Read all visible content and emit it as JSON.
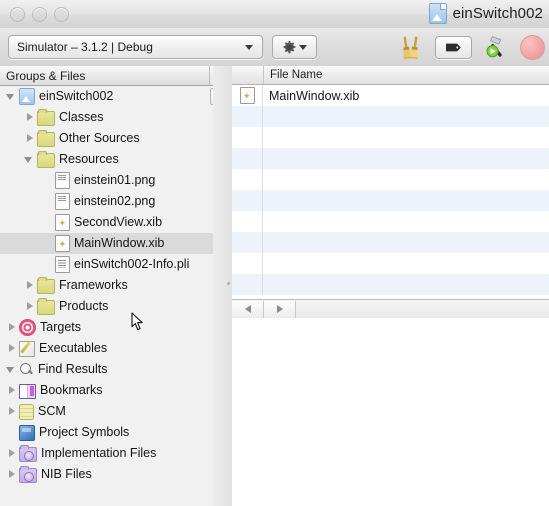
{
  "window": {
    "title": "einSwitch002",
    "doc_icon": "xcode-project-icon",
    "traffic_lights": [
      "close-button",
      "minimize-button",
      "zoom-button"
    ]
  },
  "toolbar": {
    "scheme_label": "Simulator – 3.1.2 | Debug",
    "scheme_caret": "chevron-down-icon",
    "action_gear": "gear-icon",
    "action_caret": "chevron-down-icon",
    "items": [
      {
        "name": "clean-button",
        "icon": "brooms-icon",
        "glyph": "🧹"
      },
      {
        "name": "tag-button",
        "icon": "label-tag-icon",
        "glyph": ""
      },
      {
        "name": "build-and-run-button",
        "icon": "hammer-play-icon",
        "glyph": ""
      },
      {
        "name": "stop-button",
        "icon": "stop-octagon-icon",
        "glyph": ""
      }
    ]
  },
  "sidebar": {
    "header": "Groups & Files",
    "header_split_icon": "split-view-icon",
    "list_style_button": "list-style-icon",
    "items": [
      {
        "label": "einSwitch002",
        "indent": 0,
        "twisty": "down",
        "icon": "project-icon"
      },
      {
        "label": "Classes",
        "indent": 1,
        "twisty": "right",
        "icon": "folder-icon"
      },
      {
        "label": "Other Sources",
        "indent": 1,
        "twisty": "right",
        "icon": "folder-icon"
      },
      {
        "label": "Resources",
        "indent": 1,
        "twisty": "down",
        "icon": "folder-icon"
      },
      {
        "label": "einstein01.png",
        "indent": 2,
        "twisty": "none",
        "icon": "image-file-icon"
      },
      {
        "label": "einstein02.png",
        "indent": 2,
        "twisty": "none",
        "icon": "image-file-icon"
      },
      {
        "label": "SecondView.xib",
        "indent": 2,
        "twisty": "none",
        "icon": "xib-file-icon"
      },
      {
        "label": "MainWindow.xib",
        "indent": 2,
        "twisty": "none",
        "icon": "xib-file-icon",
        "selected": true
      },
      {
        "label": "einSwitch002-Info.pli",
        "indent": 2,
        "twisty": "none",
        "icon": "plist-file-icon"
      },
      {
        "label": "Frameworks",
        "indent": 1,
        "twisty": "right",
        "icon": "folder-icon"
      },
      {
        "label": "Products",
        "indent": 1,
        "twisty": "right",
        "icon": "folder-icon"
      },
      {
        "label": "Targets",
        "indent": 0,
        "twisty": "right",
        "icon": "target-icon"
      },
      {
        "label": "Executables",
        "indent": 0,
        "twisty": "right",
        "icon": "executable-icon"
      },
      {
        "label": "Find Results",
        "indent": 0,
        "twisty": "down",
        "icon": "magnifier-icon"
      },
      {
        "label": "Bookmarks",
        "indent": 0,
        "twisty": "right",
        "icon": "book-icon"
      },
      {
        "label": "SCM",
        "indent": 0,
        "twisty": "right",
        "icon": "scm-icon"
      },
      {
        "label": "Project Symbols",
        "indent": 0,
        "twisty": "none",
        "icon": "cube-icon"
      },
      {
        "label": "Implementation Files",
        "indent": 0,
        "twisty": "right",
        "icon": "smart-folder-icon"
      },
      {
        "label": "NIB Files",
        "indent": 0,
        "twisty": "right",
        "icon": "smart-folder-icon"
      }
    ]
  },
  "file_list": {
    "columns": [
      "",
      "File Name"
    ],
    "rows": [
      {
        "icon": "xib-file-icon",
        "name": "MainWindow.xib"
      },
      {
        "icon": "",
        "name": ""
      },
      {
        "icon": "",
        "name": ""
      },
      {
        "icon": "",
        "name": ""
      },
      {
        "icon": "",
        "name": ""
      },
      {
        "icon": "",
        "name": ""
      },
      {
        "icon": "",
        "name": ""
      },
      {
        "icon": "",
        "name": ""
      },
      {
        "icon": "",
        "name": ""
      },
      {
        "icon": "",
        "name": ""
      }
    ]
  },
  "nav_bar": {
    "back": "back-arrow-icon",
    "forward": "forward-arrow-icon"
  },
  "colors": {
    "selection": "#dadada",
    "alt_row": "#eef2fb",
    "toolbar_top": "#e9e9e9",
    "accent_folder": "#d9d87d",
    "stop_red": "#f0a0a0"
  }
}
